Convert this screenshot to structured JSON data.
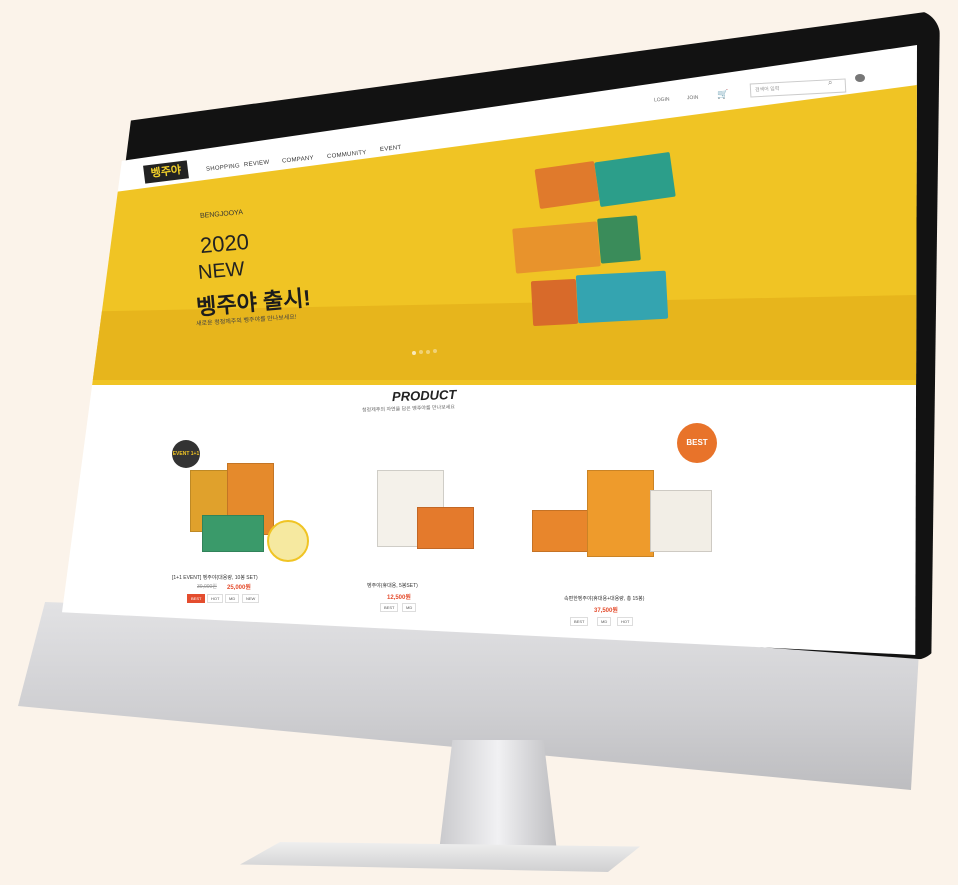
{
  "header": {
    "logo": "벵주야",
    "nav": [
      "SHOPPING",
      "REVIEW",
      "COMPANY",
      "COMMUNITY",
      "EVENT"
    ],
    "login": "LOGIN",
    "join": "JOIN",
    "search_placeholder": "검색어 입력",
    "cart_icon": "cart-icon",
    "search_icon": "search-icon",
    "chat_icon": "chat-icon"
  },
  "hero": {
    "brand": "BENGJOOYA",
    "year": "2020",
    "new": "NEW",
    "title": "벵주야 출시!",
    "subtitle": "새로운 청정제주의 벵주야를 만나보세요!"
  },
  "product_section": {
    "title": "PRODUCT",
    "subtitle": "청정제주의 자연을 담은 벵주야를 만나보세요"
  },
  "products": [
    {
      "badge": "EVENT 1+1",
      "name": "[1+1 EVENT] 벵주야(대용량, 10봉 SET)",
      "old_price": "30,000원",
      "price": "25,000원",
      "tags": [
        "BEST",
        "HOT",
        "MD",
        "NEW"
      ]
    },
    {
      "badge": "",
      "name": "벵주야(휴대용, 5봉SET)",
      "price": "12,500원",
      "tags": [
        "BEST",
        "MD"
      ]
    },
    {
      "badge": "BEST",
      "name": "속편한벵주야(휴대용+대용량, 총 15봉)",
      "price": "37,500원",
      "tags": [
        "BEST",
        "MD",
        "HOT"
      ]
    }
  ],
  "colors": {
    "hero_yellow": "#f0c424",
    "accent_red": "#e44d2e",
    "badge_orange": "#e8732a",
    "logo_bg": "#222222"
  }
}
